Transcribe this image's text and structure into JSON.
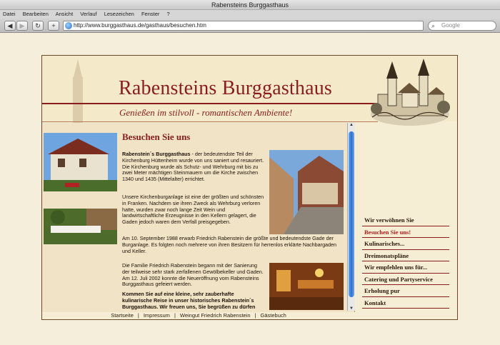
{
  "window": {
    "title": "Rabensteins Burggasthaus"
  },
  "menu": [
    "Datei",
    "Bearbeiten",
    "Ansicht",
    "Verlauf",
    "Lesezeichen",
    "Fenster",
    "?"
  ],
  "toolbar": {
    "url": "http://www.burggasthaus.de/gasthaus/besuchen.htm",
    "search_placeholder": "Google",
    "back": "◀",
    "forward": "▶",
    "reload": "↻",
    "add": "+"
  },
  "site": {
    "title": "Rabensteins Burggasthaus",
    "tagline": "Genießen im stilvoll - romantischen Ambiente!",
    "content_title": "Besuchen Sie uns",
    "paragraphs": [
      {
        "bold": "Rabenstein´s Burggasthaus",
        "text": " - der bedeutendste Teil der Kirchenburg Hüttenheim wurde von uns saniert und resauriert. Die Kirchenburg wurde als Schutz- und Wehrburg mit bis zu zwei Meter mächtigen Steinmauern um die Kirche zwischen 1340 und 1435 (Mittelalter) errichtet."
      },
      {
        "bold": "",
        "text": "Unsere Kirchenburganlage ist eine der größten und schönsten in Franken. Nachdem sie ihren Zweck als Wehrburg verloren hatte, wurden zwar noch lange Zeit Wein und landwirtschaftliche Erzeugnisse in den Kellern gelagert, die Gaden jedoch waren dem Verfall preisgegeben."
      },
      {
        "bold": "",
        "text": "Am 10. September 1988 erwarb Friedrich Rabenstein die größte und bedeutendste Gade der Burganlage. Es folgten noch mehrere von ihren Besitzern für herrenlos erklärte Nachbargaden und Keller."
      },
      {
        "bold": "",
        "text": "Die Familie Friedrich Rabenstein begann mit der Sanierung der teilweise sehr stark zerfallenen Gewölbekeller und Gaden. Am 12. Juli 2002 konnte die Neueröffnung vom Rabensteins Burggasthaus gefeiert werden."
      },
      {
        "bold": "Kommen Sie auf eine kleine, sehr zauberhafte kulinarische Reise in unser historisches Rabenstein´s Burggasthaus. Wir freuen uns, Sie begrüßen zu dürfen und",
        "text": ""
      }
    ],
    "footer_links": [
      "Startseite",
      "Impressum",
      "Weingut Friedrich Rabenstein",
      "Gästebuch"
    ],
    "footer_sep": "|",
    "nav": [
      "Wir verwöhnen Sie",
      "Besuchen Sie uns!",
      "Kulinarisches...",
      "Dreimonatspläne",
      "Wir empfehlen uns für...",
      "Catering und Partyservice",
      "Erholung pur",
      "Kontakt"
    ],
    "active_nav_index": 1,
    "colors": {
      "accent": "#8a1d1d",
      "background": "#f6eed4"
    }
  }
}
